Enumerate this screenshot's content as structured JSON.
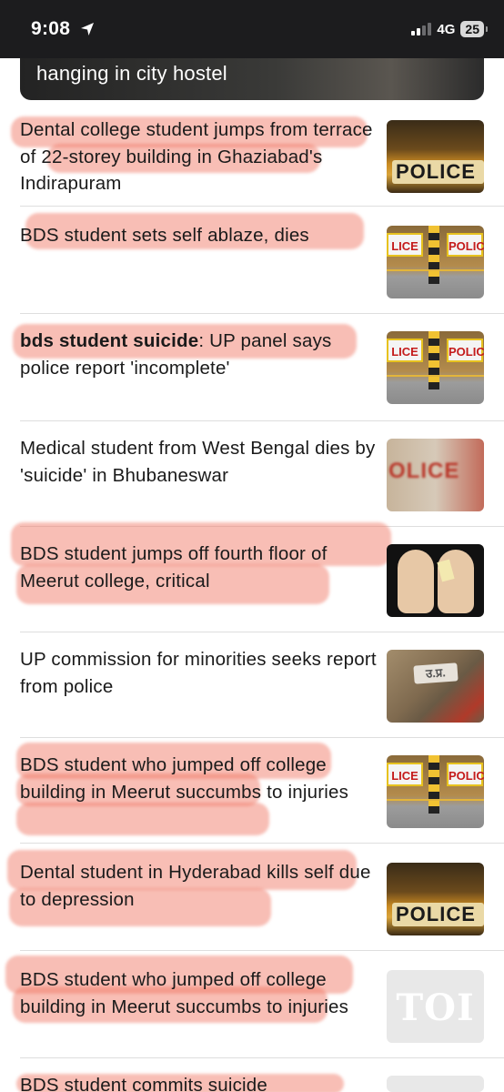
{
  "status_bar": {
    "time": "9:08",
    "network": "4G",
    "battery": "25",
    "location_icon": "location-arrow-icon",
    "signal_icon": "cellular-signal-icon"
  },
  "featured": {
    "title_fragment": "hanging in city hostel"
  },
  "news": [
    {
      "title": "Dental college student jumps from terrace of 22-storey building in Ghaziabad's Indirapuram",
      "thumb_label": "POLICE",
      "highlighted": true
    },
    {
      "title": "BDS student sets self ablaze, dies",
      "thumb_labels": [
        "LICE",
        "POLIC"
      ],
      "highlighted": true
    },
    {
      "title_bold": "bds student suicide",
      "title_rest": ": UP panel says police report 'incomplete'",
      "thumb_labels": [
        "LICE",
        "POLIC"
      ],
      "highlighted": true
    },
    {
      "title": "Medical student from West Bengal dies by 'suicide' in Bhubaneswar",
      "thumb_label": "OLICE",
      "highlighted": false
    },
    {
      "title": "BDS student jumps off fourth floor of Meerut college, critical",
      "highlighted": true
    },
    {
      "title": "UP commission for minorities seeks report from police",
      "thumb_label": "उ.प्र.",
      "highlighted": false
    },
    {
      "title": "BDS student who jumped off college building in Meerut succumbs to injuries",
      "thumb_labels": [
        "LICE",
        "POLIC"
      ],
      "highlighted": true
    },
    {
      "title": "Dental student in Hyderabad kills self due to depression",
      "thumb_label": "POLICE",
      "highlighted": true
    },
    {
      "title": "BDS student who jumped off college building in Meerut succumbs to injuries",
      "thumb_label": "TOI",
      "highlighted": true
    },
    {
      "title": "BDS student commits suicide",
      "highlighted": true
    }
  ],
  "colors": {
    "highlight": "#f07864",
    "status_bar_bg": "#1c1c1e",
    "divider": "#dedede"
  }
}
